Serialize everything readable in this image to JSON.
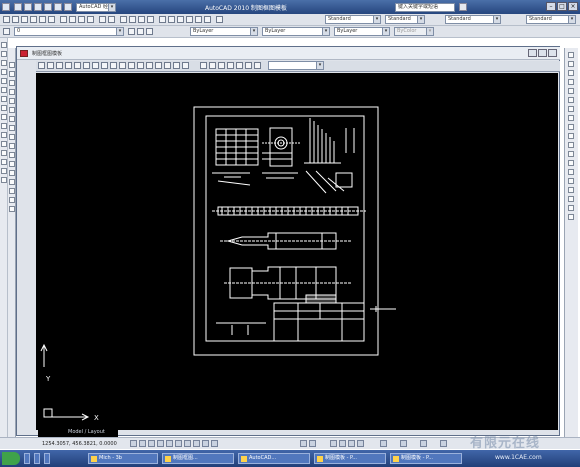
{
  "window": {
    "title": "AutoCAD 2010  制图框图模板"
  },
  "search": {
    "placeholder": "键入关键字或短语"
  },
  "workspace_combo": "AutoCAD 经典",
  "toolbar": {
    "layer_combo": "0",
    "style_combos": [
      "Standard",
      "Standard",
      "Standard",
      "Standard"
    ],
    "color_combo": "ByLayer",
    "linetype_combo": "ByLayer",
    "lineweight_combo": "ByLayer",
    "plotstyle_combo": "ByColor"
  },
  "drawing": {
    "tab_title": "制图框图模板",
    "layout_tab": "Model / Layout"
  },
  "ucs": {
    "x_label": "X",
    "y_label": "Y"
  },
  "status": {
    "coords": "1254.3057, 456.3821, 0.0000"
  },
  "taskbar": {
    "items": [
      "Mich - 3b",
      "制图框图...",
      "AutoCAD...",
      "制图模板 - P...",
      "制图模板 - P..."
    ]
  },
  "watermark": "有限元在线",
  "watermark_url": "www.1CAE.com",
  "colors": {
    "canvas": "#000000",
    "titlebar": "#26467e",
    "drawing_lines": "#ffffff"
  }
}
